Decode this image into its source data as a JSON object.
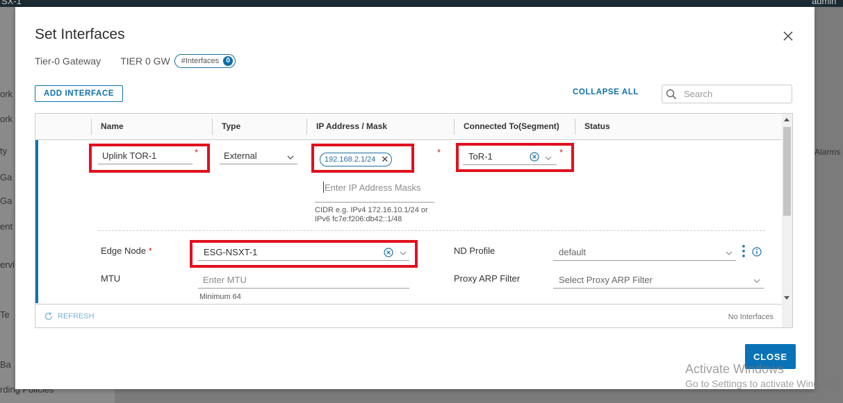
{
  "background": {
    "topbar_left": "SX-1",
    "topbar_right": "admin",
    "left_items": [
      "ork",
      "ork",
      "ty",
      "Ga",
      "Ga",
      "ent",
      "ervi",
      "Te",
      "Ba",
      "rding Policies"
    ],
    "right_alarms": "Alarms"
  },
  "modal": {
    "title": "Set Interfaces",
    "gateway_type": "Tier-0 Gateway",
    "gateway_name": "TIER 0 GW",
    "interfaces_pill": "#Interfaces",
    "interfaces_count": "0",
    "add_interface": "ADD INTERFACE",
    "collapse_all": "COLLAPSE ALL",
    "search_placeholder": "Search",
    "close_button": "CLOSE"
  },
  "grid": {
    "columns": [
      "Name",
      "Type",
      "IP Address / Mask",
      "Connected To(Segment)",
      "Status"
    ],
    "row": {
      "name": "Uplink TOR-1",
      "type": "External",
      "ip_chip": "192.168.2.1/24",
      "ip_placeholder": "Enter IP Address Masks",
      "ip_help": "CIDR e.g. IPv4 172.16.10.1/24 or IPv6 fc7e:f206:db42::1/48",
      "segment": "ToR-1",
      "edge_node_label": "Edge Node",
      "edge_node_value": "ESG-NSXT-1",
      "mtu_label": "MTU",
      "mtu_placeholder": "Enter MTU",
      "mtu_help": "Minimum 64",
      "nd_profile_label": "ND Profile",
      "nd_profile_value": "default",
      "proxy_arp_label": "Proxy ARP Filter",
      "proxy_arp_placeholder": "Select Proxy ARP Filter"
    },
    "footer": {
      "refresh": "REFRESH",
      "status": "No Interfaces"
    }
  },
  "watermark": {
    "line1": "Activate Windows",
    "line2": "Go to Settings to activate Windows."
  },
  "colors": {
    "accent": "#0e72ad",
    "highlight_box": "#e0101e",
    "required": "#d31b1b"
  }
}
